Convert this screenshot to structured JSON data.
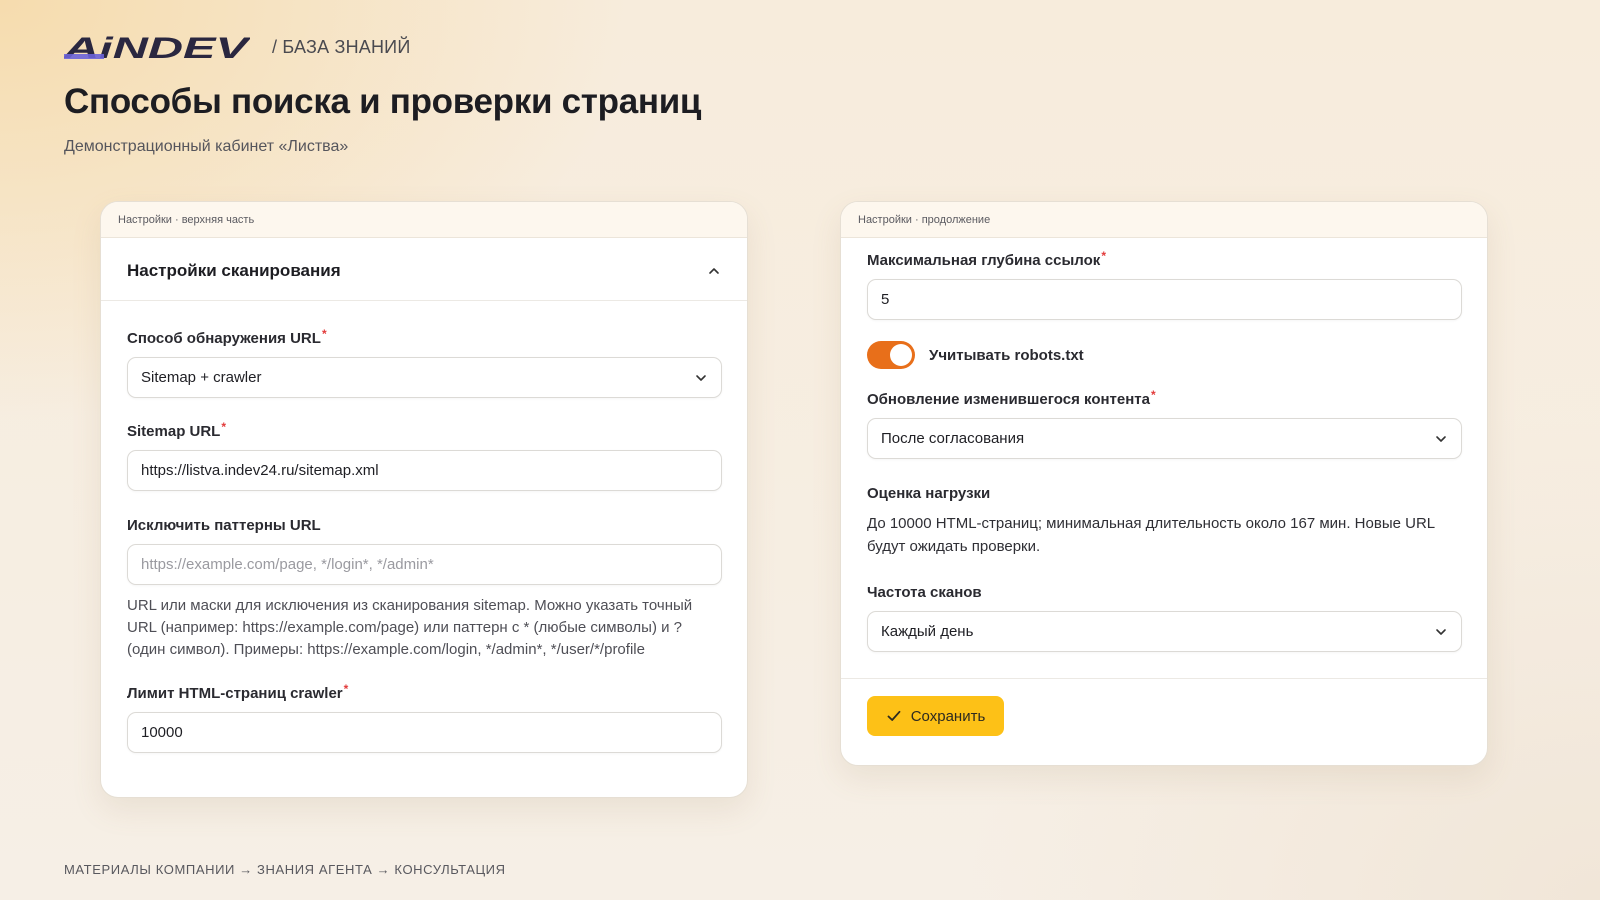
{
  "header": {
    "logo_text": "AiNDEV",
    "crumb": "/ БАЗА ЗНАНИЙ",
    "title": "Способы поиска и проверки страниц",
    "subtitle": "Демонстрационный кабинет «Листва»"
  },
  "left_card": {
    "topbar": "Настройки · верхняя часть",
    "section_title": "Настройки сканирования",
    "discovery": {
      "label": "Способ обнаружения URL",
      "value": "Sitemap + crawler"
    },
    "sitemap": {
      "label": "Sitemap URL",
      "value": "https://listva.indev24.ru/sitemap.xml"
    },
    "exclude": {
      "label": "Исключить паттерны URL",
      "placeholder": "https://example.com/page, */login*, */admin*",
      "help": "URL или маски для исключения из сканирования sitemap. Можно указать точный URL (например: https://example.com/page) или паттерн с * (любые символы) и ? (один символ). Примеры: https://example.com/login, */admin*, */user/*/profile"
    },
    "limit": {
      "label": "Лимит HTML-страниц crawler",
      "value": "10000"
    }
  },
  "right_card": {
    "topbar": "Настройки · продолжение",
    "depth": {
      "label": "Максимальная глубина ссылок",
      "value": "5"
    },
    "robots": {
      "label": "Учитывать robots.txt",
      "checked": true
    },
    "update": {
      "label": "Обновление изменившегося контента",
      "value": "После согласования"
    },
    "load": {
      "label": "Оценка нагрузки",
      "text": "До 10000 HTML-страниц; минимальная длительность около 167 мин. Новые URL будут ожидать проверки."
    },
    "frequency": {
      "label": "Частота сканов",
      "value": "Каждый день"
    },
    "save_label": "Сохранить"
  },
  "footer": "МАТЕРИАЛЫ КОМПАНИИ → ЗНАНИЯ АГЕНТА → КОНСУЛЬТАЦИЯ",
  "colors": {
    "accent_orange": "#e86f1a",
    "save_yellow": "#fdc117",
    "required_red": "#e23b3b",
    "logo_purple": "#6c63d8",
    "logo_dark": "#2a2740"
  },
  "icons": [
    "chevron-up-icon",
    "chevron-down-icon",
    "check-icon"
  ]
}
